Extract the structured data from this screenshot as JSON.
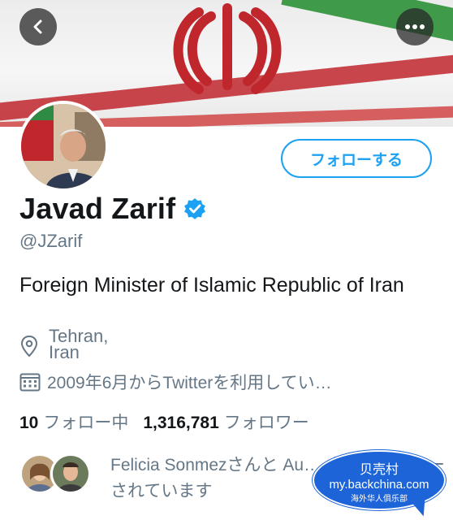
{
  "header": {
    "back_icon": "chevron-left-icon",
    "more_icon": "more-horizontal-icon"
  },
  "profile": {
    "follow_label": "フォローする",
    "name": "Javad Zarif",
    "handle": "@JZarif",
    "bio": "Foreign Minister of Islamic Republic of Iran",
    "location": "Tehran, Iran",
    "joined": "2009年6月からTwitterを利用してい…",
    "following_count": "10",
    "following_label": "フォロー中",
    "followers_count": "1,316,781",
    "followers_label": "フォロワー",
    "followed_by_text": "Felicia Sonmezさんと Au… さんにフォローされています"
  },
  "watermark": {
    "line1": "贝壳村",
    "line2": "my.backchina.com",
    "line3": "海外华人俱乐部"
  },
  "colors": {
    "accent": "#1da1f2",
    "muted_text": "#657786",
    "primary_text": "#14171a"
  }
}
